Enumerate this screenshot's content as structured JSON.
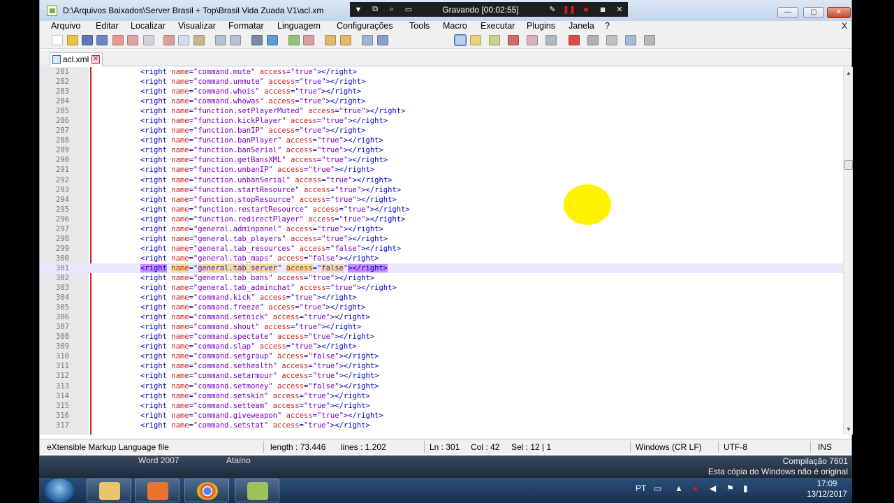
{
  "window": {
    "title": "D:\\Arquivos Baixados\\Server Brasil + Top\\Brasil Vida Zuada V1\\acl.xm",
    "min_label": "—",
    "max_label": "▢",
    "close_label": "✕"
  },
  "recorder": {
    "status": "Gravando [00:02:55]"
  },
  "menu": {
    "items": [
      "Arquivo",
      "Editar",
      "Localizar",
      "Visualizar",
      "Formatar",
      "Linguagem",
      "Configurações",
      "Tools",
      "Macro",
      "Executar",
      "Plugins",
      "Janela",
      "?"
    ],
    "close_label": "X"
  },
  "tab": {
    "name": "acl.xml",
    "close": "✕"
  },
  "editor": {
    "current_line": 301,
    "lines": [
      {
        "n": "281",
        "name": "command.mute",
        "access": "true"
      },
      {
        "n": "282",
        "name": "command.unmute",
        "access": "true"
      },
      {
        "n": "283",
        "name": "command.whois",
        "access": "true"
      },
      {
        "n": "284",
        "name": "command.whowas",
        "access": "true"
      },
      {
        "n": "285",
        "name": "function.setPlayerMuted",
        "access": "true"
      },
      {
        "n": "286",
        "name": "function.kickPlayer",
        "access": "true"
      },
      {
        "n": "287",
        "name": "function.banIP",
        "access": "true"
      },
      {
        "n": "288",
        "name": "function.banPlayer",
        "access": "true"
      },
      {
        "n": "289",
        "name": "function.banSerial",
        "access": "true"
      },
      {
        "n": "290",
        "name": "function.getBansXML",
        "access": "true"
      },
      {
        "n": "291",
        "name": "function.unbanIP",
        "access": "true"
      },
      {
        "n": "292",
        "name": "function.unbanSerial",
        "access": "true"
      },
      {
        "n": "293",
        "name": "function.startResource",
        "access": "true"
      },
      {
        "n": "294",
        "name": "function.stopResource",
        "access": "true"
      },
      {
        "n": "295",
        "name": "function.restartResource",
        "access": "true"
      },
      {
        "n": "296",
        "name": "function.redirectPlayer",
        "access": "true"
      },
      {
        "n": "297",
        "name": "general.adminpanel",
        "access": "true"
      },
      {
        "n": "298",
        "name": "general.tab_players",
        "access": "true"
      },
      {
        "n": "299",
        "name": "general.tab_resources",
        "access": "false"
      },
      {
        "n": "300",
        "name": "general.tab_maps",
        "access": "false"
      },
      {
        "n": "301",
        "name": "general.tab_server",
        "access": "false"
      },
      {
        "n": "302",
        "name": "general.tab_bans",
        "access": "true"
      },
      {
        "n": "303",
        "name": "general.tab_adminchat",
        "access": "true"
      },
      {
        "n": "304",
        "name": "command.kick",
        "access": "true"
      },
      {
        "n": "305",
        "name": "command.freeze",
        "access": "true"
      },
      {
        "n": "306",
        "name": "command.setnick",
        "access": "true"
      },
      {
        "n": "307",
        "name": "command.shout",
        "access": "true"
      },
      {
        "n": "308",
        "name": "command.spectate",
        "access": "true"
      },
      {
        "n": "309",
        "name": "command.slap",
        "access": "true"
      },
      {
        "n": "310",
        "name": "command.setgroup",
        "access": "false"
      },
      {
        "n": "311",
        "name": "command.sethealth",
        "access": "true"
      },
      {
        "n": "312",
        "name": "command.setarmour",
        "access": "true"
      },
      {
        "n": "313",
        "name": "command.setmoney",
        "access": "false"
      },
      {
        "n": "314",
        "name": "command.setskin",
        "access": "true"
      },
      {
        "n": "315",
        "name": "command.setteam",
        "access": "true"
      },
      {
        "n": "316",
        "name": "command.giveweapon",
        "access": "true"
      },
      {
        "n": "317",
        "name": "command.setstat",
        "access": "true"
      }
    ]
  },
  "status": {
    "filetype": "eXtensible Markup Language file",
    "length": "length : 73.446",
    "lines": "lines : 1.202",
    "ln": "Ln : 301",
    "col": "Col : 42",
    "sel": "Sel : 12 | 1",
    "eol": "Windows (CR LF)",
    "encoding": "UTF-8",
    "mode": "INS"
  },
  "desktop": {
    "label1": "Word 2007",
    "label2": "Ataíno",
    "watermark1": "Compilação 7601",
    "watermark2": "Esta cópia do Windows não é original"
  },
  "taskbar": {
    "lang": "PT",
    "time": "17:09",
    "date": "13/12/2017"
  },
  "colors": {
    "tag": "#0000c8",
    "attr": "#d21e1e",
    "value": "#7a00c8",
    "current_line": "#e8e8ff",
    "selection": "#c88cff",
    "cursor_dot": "#fff200"
  }
}
